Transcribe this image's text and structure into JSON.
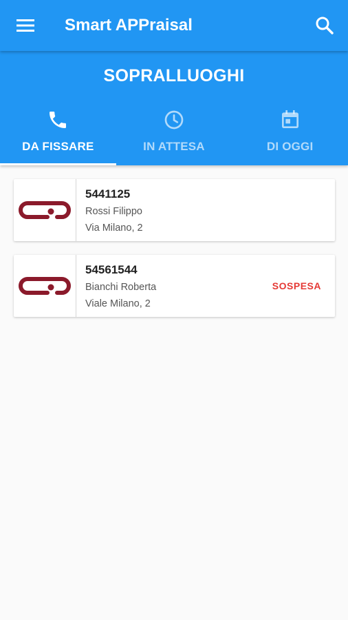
{
  "app_bar": {
    "title": "Smart APPraisal",
    "menu_icon": "hamburger-menu-icon",
    "search_icon": "search-icon"
  },
  "header": {
    "title": "SOPRALLUOGHI"
  },
  "tabs": [
    {
      "label": "DA FISSARE",
      "icon": "phone-icon",
      "active": true
    },
    {
      "label": "IN ATTESA",
      "icon": "clock-icon",
      "active": false
    },
    {
      "label": "DI OGGI",
      "icon": "calendar-icon",
      "active": false
    }
  ],
  "items": [
    {
      "code": "5441125",
      "name": "Rossi Filippo",
      "address": "Via Milano, 2",
      "status": ""
    },
    {
      "code": "54561544",
      "name": "Bianchi Roberta",
      "address": "Viale Milano, 2",
      "status": "SOSPESA"
    }
  ],
  "colors": {
    "primary": "#2196f3",
    "logo": "#8b1a2b",
    "status_suspended": "#e53935",
    "background": "#fafafa"
  }
}
